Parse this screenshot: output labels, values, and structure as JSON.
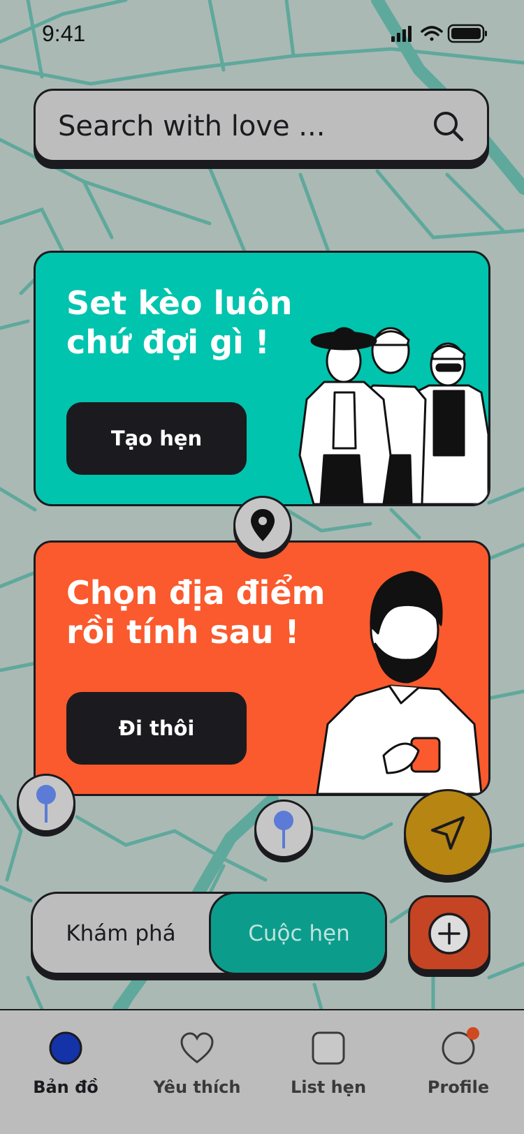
{
  "status": {
    "time": "9:41"
  },
  "search": {
    "placeholder": "Search with love ..."
  },
  "cards": [
    {
      "title": "Set kèo luôn\nchứ đợi gì !",
      "button": "Tạo hẹn"
    },
    {
      "title": "Chọn địa điểm\nrồi tính sau !",
      "button": "Đi thôi"
    }
  ],
  "toggle": {
    "left": "Khám phá",
    "right": "Cuộc hẹn",
    "selected": "Cuộc hẹn"
  },
  "tabs": [
    {
      "label": "Bản đồ",
      "icon": "map-dot-icon",
      "active": true
    },
    {
      "label": "Yêu thích",
      "icon": "heart-icon",
      "active": false
    },
    {
      "label": "List hẹn",
      "icon": "list-square-icon",
      "active": false
    },
    {
      "label": "Profile",
      "icon": "profile-circle-icon",
      "active": false,
      "badge": true
    }
  ],
  "colors": {
    "map_bg": "#aab9b4",
    "map_roads": "#5fa89c",
    "teal_card": "#00c4ae",
    "orange_card": "#fa5a2d",
    "toggle_active": "#0c9c8c",
    "locate_button": "#b68512",
    "add_button": "#c44423",
    "active_tab_dot": "#1433a8",
    "badge": "#d04a20"
  }
}
